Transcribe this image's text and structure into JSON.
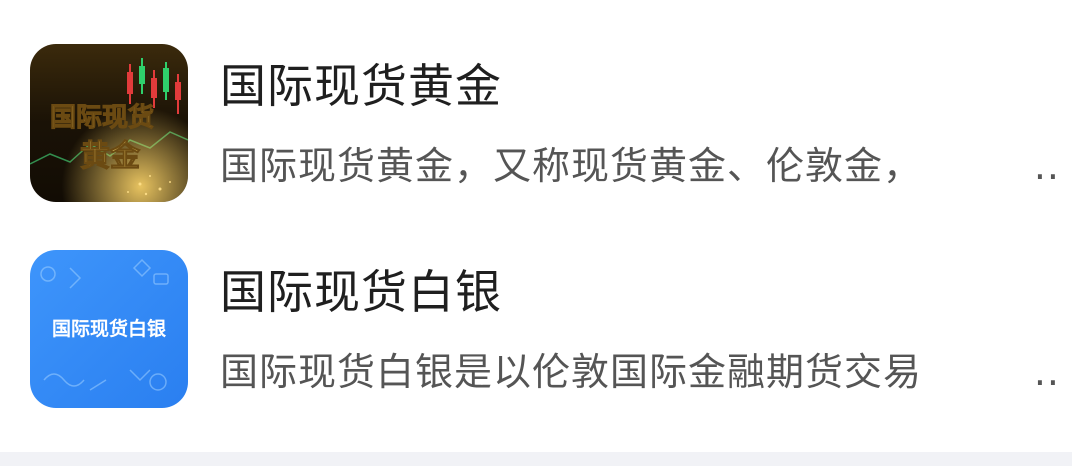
{
  "items": [
    {
      "icon_name": "gold-spot-chart-icon",
      "icon_text_line1": "国际现货",
      "icon_text_line2": "黄金",
      "title": "国际现货黄金",
      "description": "国际现货黄金，又称现货黄金、伦敦金，",
      "ellipsis": ".."
    },
    {
      "icon_name": "silver-spot-icon",
      "icon_text": "国际现货白银",
      "title": "国际现货白银",
      "description": "国际现货白银是以伦敦国际金融期货交易",
      "ellipsis": ".."
    }
  ],
  "colors": {
    "gold_icon_bg": "#1a1206",
    "gold_text": "#f4d36a",
    "silver_icon_bg": "#2e86f5",
    "title": "#1f1f1f",
    "description": "#555555"
  }
}
